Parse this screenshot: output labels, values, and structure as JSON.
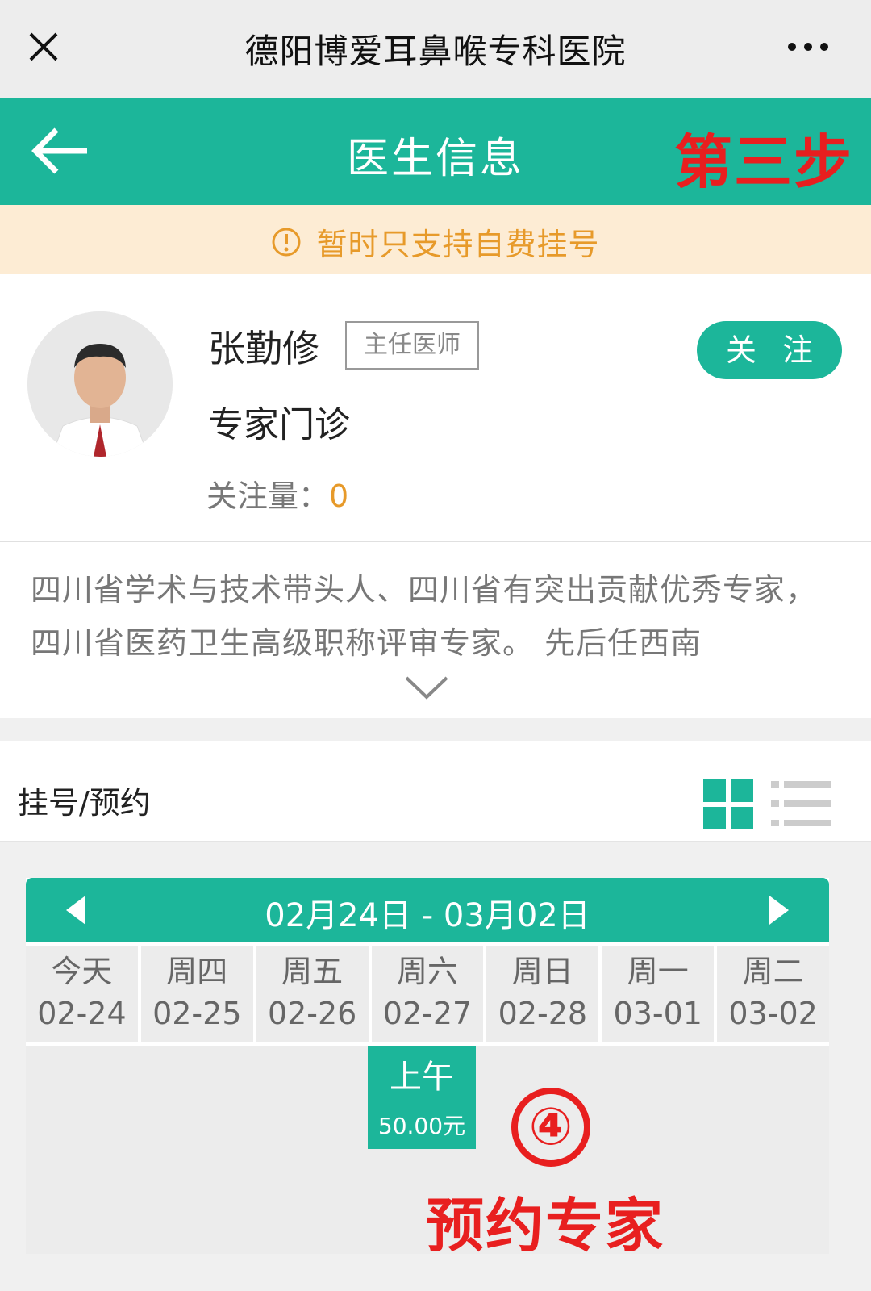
{
  "window": {
    "title": "德阳博爱耳鼻喉专科医院"
  },
  "header": {
    "title": "医生信息",
    "step_annotation": "第三步"
  },
  "notice": {
    "text": "暂时只支持自费挂号"
  },
  "doctor": {
    "name": "张勤修",
    "rank": "主任医师",
    "clinic": "专家门诊",
    "follow_label": "关注量：",
    "follow_count": "0",
    "follow_button": "关 注",
    "intro": "四川省学术与技术带头人、四川省有突出贡献优秀专家，四川省医药卫生高级职称评审专家。 先后任西南"
  },
  "booking": {
    "title": "挂号/预约",
    "week_range": "02月24日 - 03月02日",
    "days": [
      {
        "weekday": "今天",
        "date": "02-24"
      },
      {
        "weekday": "周四",
        "date": "02-25"
      },
      {
        "weekday": "周五",
        "date": "02-26"
      },
      {
        "weekday": "周六",
        "date": "02-27"
      },
      {
        "weekday": "周日",
        "date": "02-28"
      },
      {
        "weekday": "周一",
        "date": "03-01"
      },
      {
        "weekday": "周二",
        "date": "03-02"
      }
    ],
    "slot": {
      "period": "上午",
      "price": "50.00元"
    }
  },
  "annotation": {
    "number": "④",
    "text": "预约专家"
  },
  "icons": [
    "close-icon",
    "more-icon",
    "back-arrow-icon",
    "warning-icon",
    "chevron-down-icon",
    "grid-view-icon",
    "list-view-icon",
    "prev-week-icon",
    "next-week-icon"
  ],
  "colors": {
    "accent": "#1cb69a",
    "notice_bg": "#fdecd4",
    "notice_text": "#e79a2a",
    "annotation": "#e81f1f"
  }
}
